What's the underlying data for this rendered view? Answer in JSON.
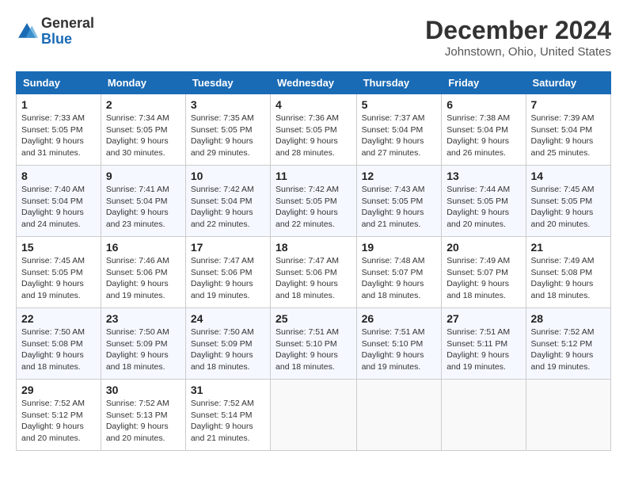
{
  "header": {
    "logo": {
      "general": "General",
      "blue": "Blue"
    },
    "title": "December 2024",
    "subtitle": "Johnstown, Ohio, United States"
  },
  "days_of_week": [
    "Sunday",
    "Monday",
    "Tuesday",
    "Wednesday",
    "Thursday",
    "Friday",
    "Saturday"
  ],
  "weeks": [
    [
      {
        "day": 1,
        "sunrise": "7:33 AM",
        "sunset": "5:05 PM",
        "daylight": "9 hours and 31 minutes."
      },
      {
        "day": 2,
        "sunrise": "7:34 AM",
        "sunset": "5:05 PM",
        "daylight": "9 hours and 30 minutes."
      },
      {
        "day": 3,
        "sunrise": "7:35 AM",
        "sunset": "5:05 PM",
        "daylight": "9 hours and 29 minutes."
      },
      {
        "day": 4,
        "sunrise": "7:36 AM",
        "sunset": "5:05 PM",
        "daylight": "9 hours and 28 minutes."
      },
      {
        "day": 5,
        "sunrise": "7:37 AM",
        "sunset": "5:04 PM",
        "daylight": "9 hours and 27 minutes."
      },
      {
        "day": 6,
        "sunrise": "7:38 AM",
        "sunset": "5:04 PM",
        "daylight": "9 hours and 26 minutes."
      },
      {
        "day": 7,
        "sunrise": "7:39 AM",
        "sunset": "5:04 PM",
        "daylight": "9 hours and 25 minutes."
      }
    ],
    [
      {
        "day": 8,
        "sunrise": "7:40 AM",
        "sunset": "5:04 PM",
        "daylight": "9 hours and 24 minutes."
      },
      {
        "day": 9,
        "sunrise": "7:41 AM",
        "sunset": "5:04 PM",
        "daylight": "9 hours and 23 minutes."
      },
      {
        "day": 10,
        "sunrise": "7:42 AM",
        "sunset": "5:04 PM",
        "daylight": "9 hours and 22 minutes."
      },
      {
        "day": 11,
        "sunrise": "7:42 AM",
        "sunset": "5:05 PM",
        "daylight": "9 hours and 22 minutes."
      },
      {
        "day": 12,
        "sunrise": "7:43 AM",
        "sunset": "5:05 PM",
        "daylight": "9 hours and 21 minutes."
      },
      {
        "day": 13,
        "sunrise": "7:44 AM",
        "sunset": "5:05 PM",
        "daylight": "9 hours and 20 minutes."
      },
      {
        "day": 14,
        "sunrise": "7:45 AM",
        "sunset": "5:05 PM",
        "daylight": "9 hours and 20 minutes."
      }
    ],
    [
      {
        "day": 15,
        "sunrise": "7:45 AM",
        "sunset": "5:05 PM",
        "daylight": "9 hours and 19 minutes."
      },
      {
        "day": 16,
        "sunrise": "7:46 AM",
        "sunset": "5:06 PM",
        "daylight": "9 hours and 19 minutes."
      },
      {
        "day": 17,
        "sunrise": "7:47 AM",
        "sunset": "5:06 PM",
        "daylight": "9 hours and 19 minutes."
      },
      {
        "day": 18,
        "sunrise": "7:47 AM",
        "sunset": "5:06 PM",
        "daylight": "9 hours and 18 minutes."
      },
      {
        "day": 19,
        "sunrise": "7:48 AM",
        "sunset": "5:07 PM",
        "daylight": "9 hours and 18 minutes."
      },
      {
        "day": 20,
        "sunrise": "7:49 AM",
        "sunset": "5:07 PM",
        "daylight": "9 hours and 18 minutes."
      },
      {
        "day": 21,
        "sunrise": "7:49 AM",
        "sunset": "5:08 PM",
        "daylight": "9 hours and 18 minutes."
      }
    ],
    [
      {
        "day": 22,
        "sunrise": "7:50 AM",
        "sunset": "5:08 PM",
        "daylight": "9 hours and 18 minutes."
      },
      {
        "day": 23,
        "sunrise": "7:50 AM",
        "sunset": "5:09 PM",
        "daylight": "9 hours and 18 minutes."
      },
      {
        "day": 24,
        "sunrise": "7:50 AM",
        "sunset": "5:09 PM",
        "daylight": "9 hours and 18 minutes."
      },
      {
        "day": 25,
        "sunrise": "7:51 AM",
        "sunset": "5:10 PM",
        "daylight": "9 hours and 18 minutes."
      },
      {
        "day": 26,
        "sunrise": "7:51 AM",
        "sunset": "5:10 PM",
        "daylight": "9 hours and 19 minutes."
      },
      {
        "day": 27,
        "sunrise": "7:51 AM",
        "sunset": "5:11 PM",
        "daylight": "9 hours and 19 minutes."
      },
      {
        "day": 28,
        "sunrise": "7:52 AM",
        "sunset": "5:12 PM",
        "daylight": "9 hours and 19 minutes."
      }
    ],
    [
      {
        "day": 29,
        "sunrise": "7:52 AM",
        "sunset": "5:12 PM",
        "daylight": "9 hours and 20 minutes."
      },
      {
        "day": 30,
        "sunrise": "7:52 AM",
        "sunset": "5:13 PM",
        "daylight": "9 hours and 20 minutes."
      },
      {
        "day": 31,
        "sunrise": "7:52 AM",
        "sunset": "5:14 PM",
        "daylight": "9 hours and 21 minutes."
      },
      null,
      null,
      null,
      null
    ]
  ]
}
